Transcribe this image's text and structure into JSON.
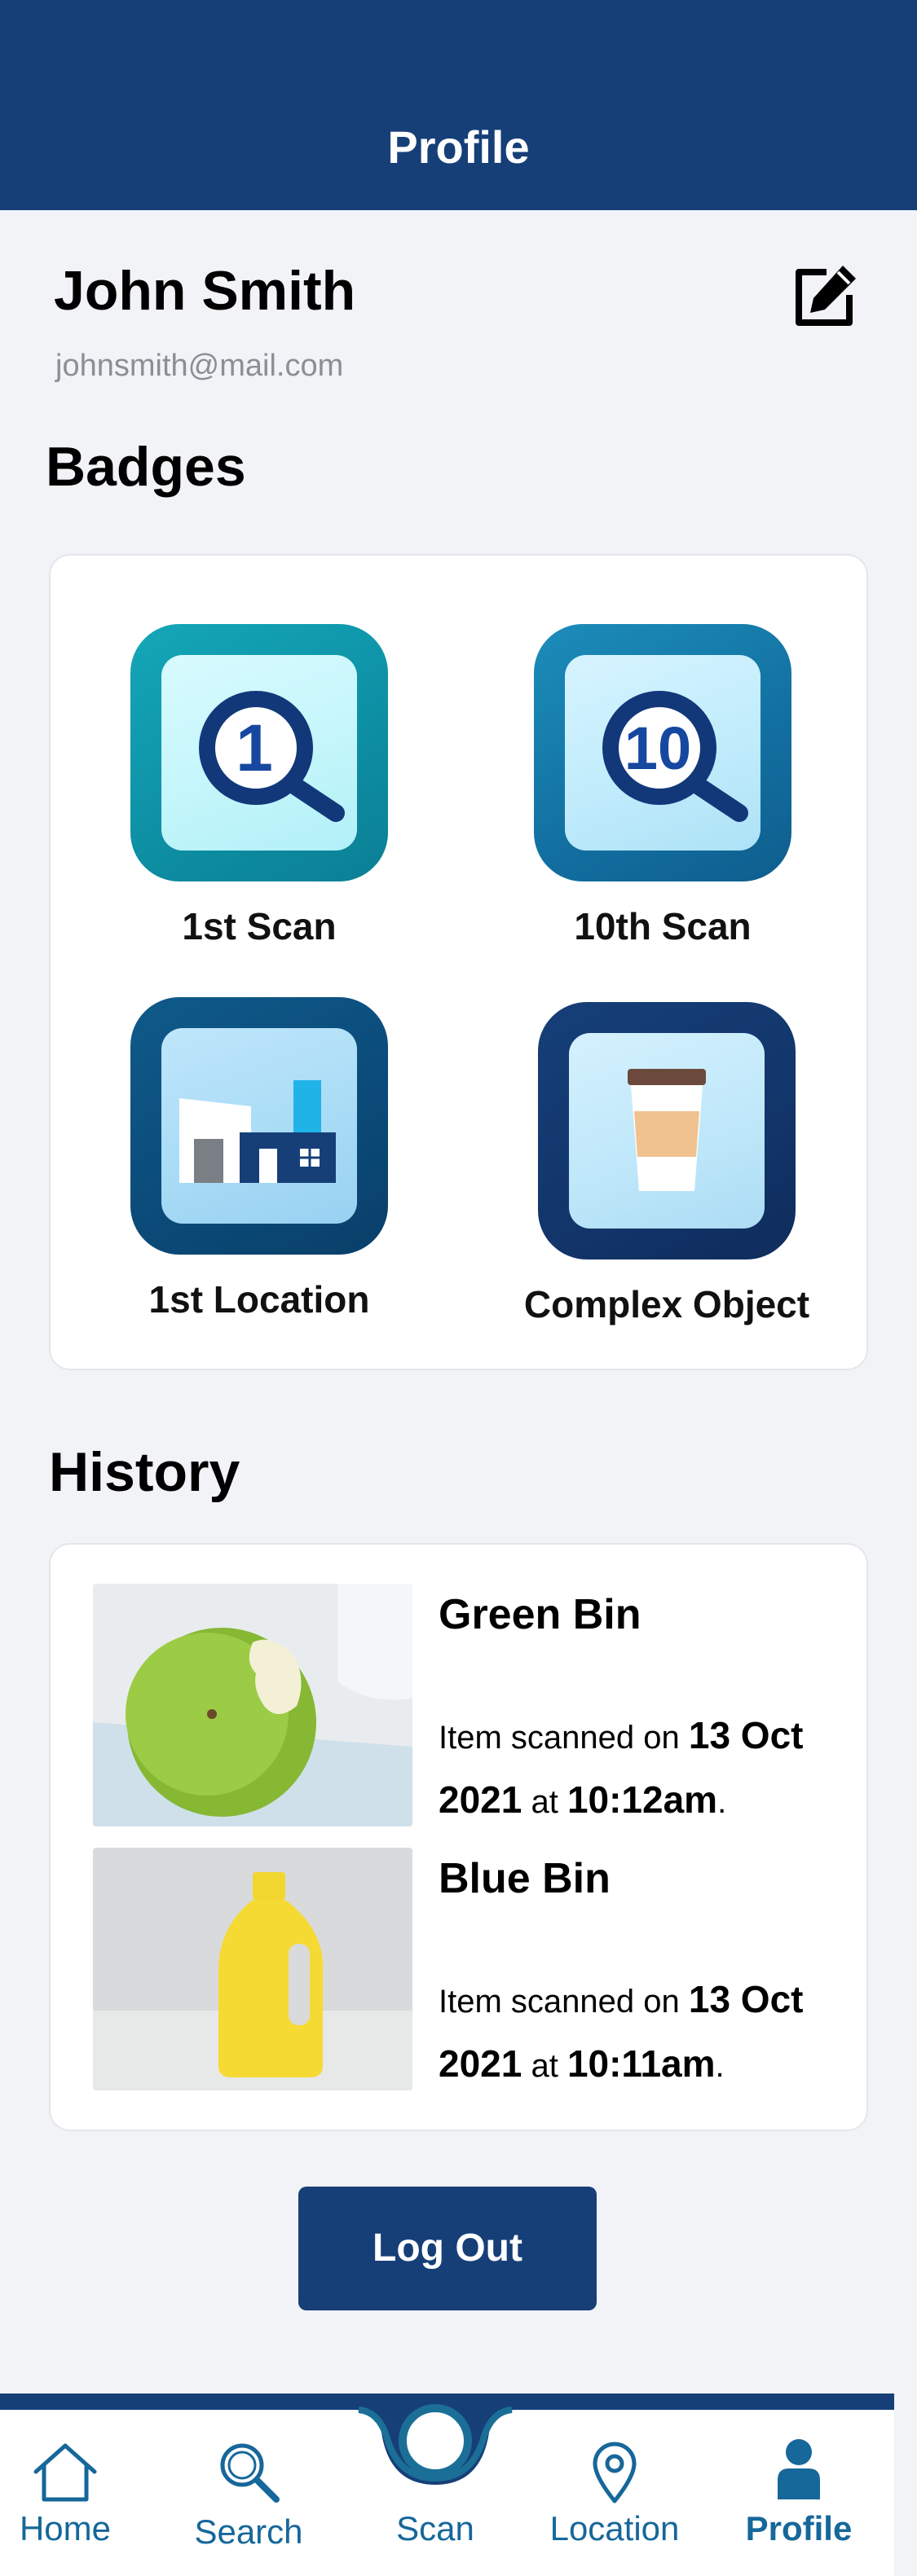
{
  "header": {
    "title": "Profile"
  },
  "user": {
    "name": "John Smith",
    "email": "johnsmith@mail.com"
  },
  "badges": {
    "title": "Badges",
    "items": [
      {
        "label": "1st Scan",
        "icon": "magnifier-1-icon",
        "number": "1"
      },
      {
        "label": "10th Scan",
        "icon": "magnifier-10-icon",
        "number": "10"
      },
      {
        "label": "1st Location",
        "icon": "building-icon"
      },
      {
        "label": "Complex Object",
        "icon": "coffee-cup-icon"
      }
    ]
  },
  "history": {
    "title": "History",
    "items": [
      {
        "bin": "Green Bin",
        "prefix": "Item scanned on ",
        "date": "13 Oct 2021",
        "mid": " at ",
        "time": "10:12am",
        "suffix": ".",
        "image": "apple-photo"
      },
      {
        "bin": "Blue Bin",
        "prefix": "Item scanned on ",
        "date": "13 Oct 2021",
        "mid": " at ",
        "time": "10:11am",
        "suffix": ".",
        "image": "bottle-photo"
      }
    ]
  },
  "logout_label": "Log Out",
  "nav": {
    "items": [
      {
        "label": "Home",
        "icon": "home-icon"
      },
      {
        "label": "Search",
        "icon": "search-icon"
      },
      {
        "label": "Scan",
        "icon": "scan-icon"
      },
      {
        "label": "Location",
        "icon": "location-pin-icon"
      },
      {
        "label": "Profile",
        "icon": "person-icon",
        "active": true
      }
    ]
  },
  "colors": {
    "primary": "#163f78",
    "nav_text": "#16679a",
    "background": "#f1f3f7"
  }
}
